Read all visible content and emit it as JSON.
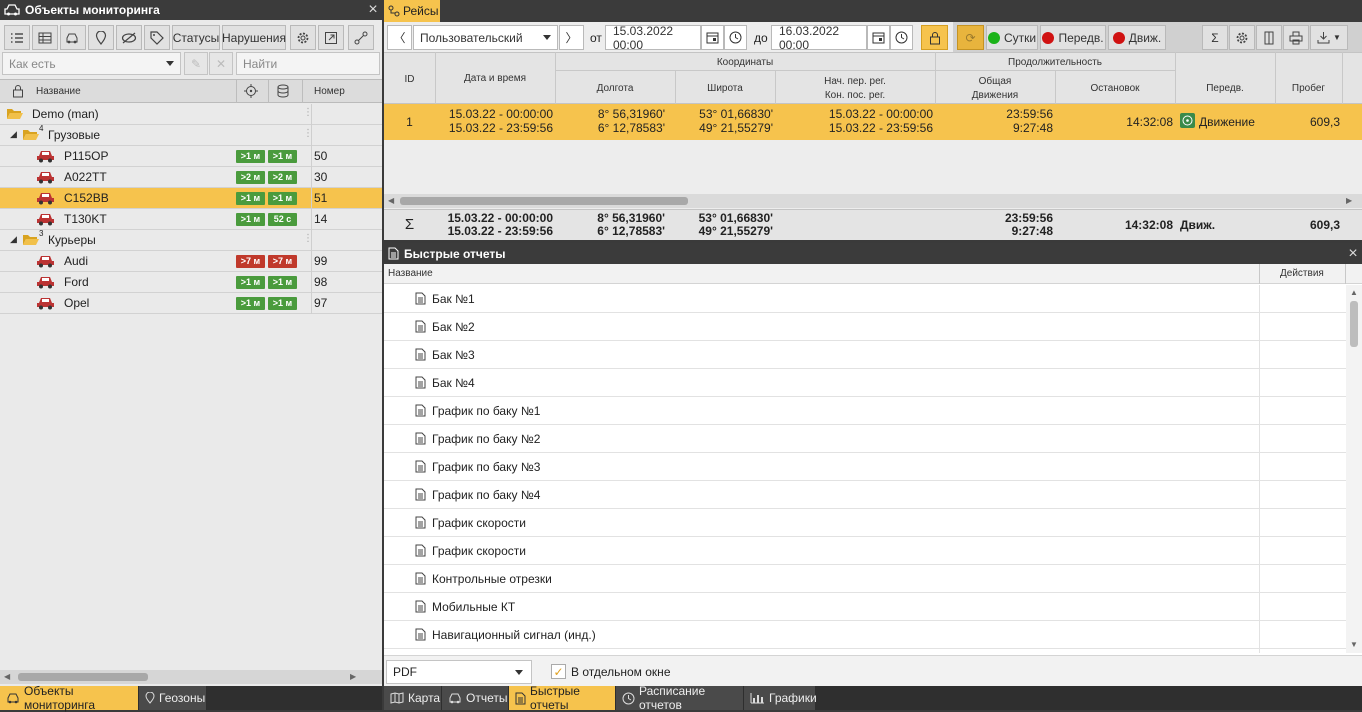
{
  "left_panel": {
    "title": "Объекты мониторинга",
    "toolbar": {
      "statuses_label": "Статусы",
      "violations_label": "Нарушения"
    },
    "filter": {
      "value": "Как есть",
      "search_placeholder": "Найти"
    },
    "columns": {
      "name": "Название",
      "number": "Номер"
    },
    "tree": {
      "root": "Demo (man)",
      "groups": [
        {
          "label": "Грузовые",
          "count": "4"
        },
        {
          "label": "Курьеры",
          "count": "3"
        }
      ],
      "vehicles": [
        {
          "name": "P115OP",
          "b1": ">1 м",
          "b2": ">1 м",
          "c1": "#4a9b3d",
          "c2": "#4a9b3d",
          "number": "50"
        },
        {
          "name": "A022TT",
          "b1": ">2 м",
          "b2": ">2 м",
          "c1": "#4a9b3d",
          "c2": "#4a9b3d",
          "number": "30"
        },
        {
          "name": "C152BB",
          "b1": ">1 м",
          "b2": ">1 м",
          "c1": "#4a9b3d",
          "c2": "#4a9b3d",
          "number": "51"
        },
        {
          "name": "T130KT",
          "b1": ">1 м",
          "b2": "52 с",
          "c1": "#4a9b3d",
          "c2": "#4a9b3d",
          "number": "14"
        },
        {
          "name": "Audi",
          "b1": ">7 м",
          "b2": ">7 м",
          "c1": "#c0392b",
          "c2": "#c0392b",
          "number": "99"
        },
        {
          "name": "Ford",
          "b1": ">1 м",
          "b2": ">1 м",
          "c1": "#4a9b3d",
          "c2": "#4a9b3d",
          "number": "98"
        },
        {
          "name": "Opel",
          "b1": ">1 м",
          "b2": ">1 м",
          "c1": "#4a9b3d",
          "c2": "#4a9b3d",
          "number": "97"
        }
      ]
    },
    "tabs": {
      "objects": "Объекты мониторинга",
      "geozones": "Геозоны"
    }
  },
  "trips": {
    "tab_label": "Рейсы",
    "period": "Пользовательский",
    "from_label": "от",
    "from_value": "15.03.2022 00:00",
    "to_label": "до",
    "to_value": "16.03.2022 00:00",
    "filters": {
      "day": "Сутки",
      "transfer": "Передв.",
      "motion": "Движ."
    },
    "colors": {
      "green": "#1bb319",
      "red": "#d01212",
      "accent": "#f6c34d"
    },
    "headers": {
      "id": "ID",
      "datetime": "Дата и время",
      "coords": "Координаты",
      "lon": "Долгота",
      "lat": "Широта",
      "reg1": "Нач. пер. рег.",
      "reg2": "Кон. пос. рег.",
      "duration": "Продолжительность",
      "total1": "Общая",
      "total2": "Движения",
      "stop": "Остановок",
      "transfer": "Передв.",
      "mileage": "Пробег"
    },
    "row": {
      "id": "1",
      "dt1": "15.03.22 - 00:00:00",
      "dt2": "15.03.22 - 23:59:56",
      "lon1": "8° 56,31960'",
      "lon2": "6° 12,78583'",
      "lat1": "53° 01,66830'",
      "lat2": "49° 21,55279'",
      "reg1": "15.03.22 - 00:00:00",
      "reg2": "15.03.22 - 23:59:56",
      "tot1": "23:59:56",
      "tot2": "9:27:48",
      "stop": "14:32:08",
      "transfer": "Движение",
      "mileage": "609,3"
    },
    "total": {
      "symbol": "Σ",
      "dt1": "15.03.22 - 00:00:00",
      "dt2": "15.03.22 - 23:59:56",
      "lon1": "8° 56,31960'",
      "lon2": "6° 12,78583'",
      "lat1": "53° 01,66830'",
      "lat2": "49° 21,55279'",
      "tot1": "23:59:56",
      "tot2": "9:27:48",
      "stop": "14:32:08",
      "transfer": "Движ.",
      "mileage": "609,3"
    }
  },
  "quick_reports": {
    "title": "Быстрые отчеты",
    "col_name": "Название",
    "col_actions": "Действия",
    "items": [
      "Бак №1",
      "Бак №2",
      "Бак №3",
      "Бак №4",
      "График по баку №1",
      "График по баку №2",
      "График по баку №3",
      "График по баку №4",
      "График скорости",
      "График скорости",
      "Контрольные отрезки",
      "Мобильные КТ",
      "Навигационный сигнал (инд.)"
    ],
    "format": "PDF",
    "separate_window": "В отдельном окне",
    "separate_window_checked": true
  },
  "bottom_tabs": {
    "map": "Карта",
    "reports": "Отчеты",
    "quick": "Быстрые отчеты",
    "schedule": "Расписание отчетов",
    "charts": "Графики"
  }
}
